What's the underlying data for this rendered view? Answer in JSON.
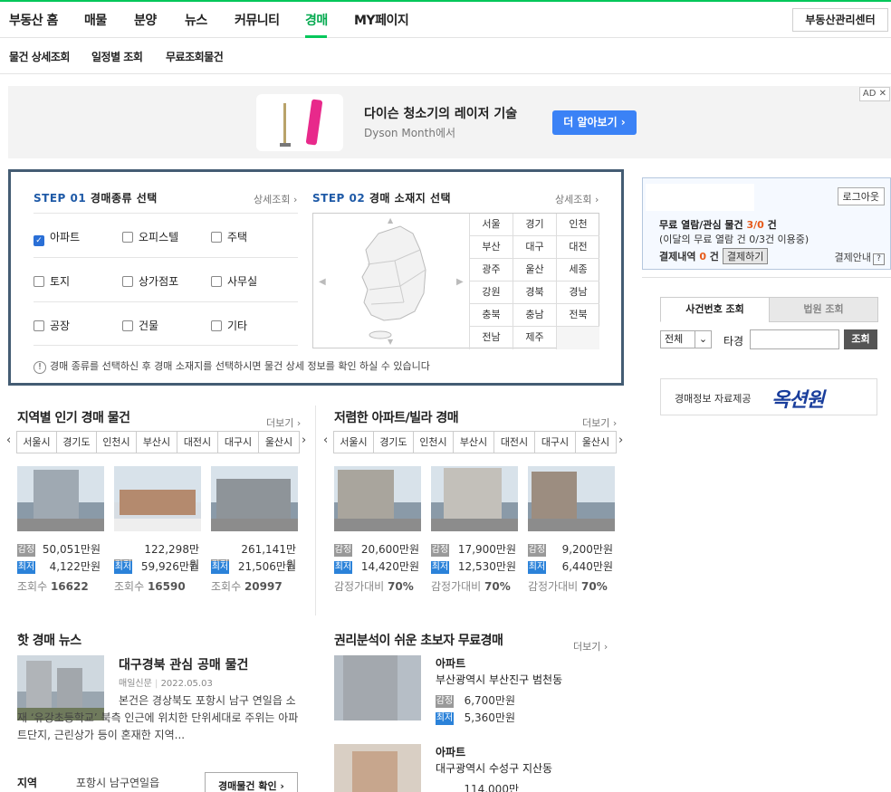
{
  "gnb": {
    "items": [
      "부동산 홈",
      "매물",
      "분양",
      "뉴스",
      "커뮤니티",
      "경매",
      "MY페이지"
    ],
    "realty_center": "부동산관리센터"
  },
  "lnb": {
    "items": [
      "물건 상세조회",
      "일정별 조회",
      "무료조회물건"
    ]
  },
  "ad": {
    "title": "다이슨 청소기의 레이저 기술",
    "sub": "Dyson Month에서",
    "button": "더 알아보기 ›",
    "tag": "AD ✕"
  },
  "step1": {
    "title_num": "STEP 01",
    "title_text": "경매종류 선택",
    "more": "상세조회 ›",
    "options": [
      [
        "아파트",
        "오피스텔",
        "주택"
      ],
      [
        "토지",
        "상가점포",
        "사무실"
      ],
      [
        "공장",
        "건물",
        "기타"
      ]
    ],
    "checked": "아파트"
  },
  "step2": {
    "title_num": "STEP 02",
    "title_text": "경매 소재지 선택",
    "more": "상세조회 ›",
    "regions": [
      "서울",
      "경기",
      "인천",
      "부산",
      "대구",
      "대전",
      "광주",
      "울산",
      "세종",
      "강원",
      "경북",
      "경남",
      "충북",
      "충남",
      "전북",
      "전남",
      "제주",
      ""
    ]
  },
  "notice": "경매 종류를 선택하신 후 경매 소재지를 선택하시면 물건 상세 정보를 확인 하실 수 있습니다",
  "side": {
    "logout": "로그아웃",
    "line1_a": "무료 열람/관심 물건 ",
    "line1_count": "3/0",
    "line1_b": " 건",
    "line2": "(이달의 무료 열람 건 0/3건 이용중)",
    "line3_a": "결제내역 ",
    "line3_count": "0",
    "line3_b": " 건",
    "pay_btn": "결제하기",
    "pay_guide": "결제안내",
    "tab_case": "사건번호 조회",
    "tab_court": "법원 조회",
    "select": "전체",
    "input_label": "타경",
    "search_btn": "조회",
    "provider_text": "경매정보 자료제공",
    "provider_logo": "옥션원"
  },
  "popular": {
    "title": "지역별 인기 경매 물건",
    "more": "더보기 ›",
    "tabs": [
      "서울시",
      "경기도",
      "인천시",
      "부산시",
      "대전시",
      "대구시",
      "울산시"
    ],
    "items": [
      {
        "appraisal": "50,051만원",
        "min": "4,122만원",
        "views_label": "조회수",
        "views": "16622"
      },
      {
        "appraisal": "122,298만원",
        "min": "59,926만원",
        "views_label": "조회수",
        "views": "16590"
      },
      {
        "appraisal": "261,141만원",
        "min": "21,506만원",
        "views_label": "조회수",
        "views": "20997"
      }
    ]
  },
  "cheap": {
    "title": "저렴한 아파트/빌라 경매",
    "more": "더보기 ›",
    "tabs": [
      "서울시",
      "경기도",
      "인천시",
      "부산시",
      "대전시",
      "대구시",
      "울산시"
    ],
    "items": [
      {
        "appraisal": "20,600만원",
        "min": "14,420만원",
        "ratio_label": "감정가대비",
        "ratio": "70%"
      },
      {
        "appraisal": "17,900만원",
        "min": "12,530만원",
        "ratio_label": "감정가대비",
        "ratio": "70%"
      },
      {
        "appraisal": "9,200만원",
        "min": "6,440만원",
        "ratio_label": "감정가대비",
        "ratio": "70%"
      }
    ]
  },
  "labels": {
    "appraisal": "감정",
    "min": "최저"
  },
  "news": {
    "title": "핫 경매 뉴스",
    "headline": "대구경북 관심 공매 물건",
    "source": "매일신문",
    "date": "2022.05.03",
    "body": "본건은 경상북도 포항시 남구 연일읍 소재 ‘유강초등학교’ 북측 인근에 위치한 단위세대로 주위는 아파트단지, 근린상가 등이 혼재한 지역...",
    "region_label": "지역",
    "region_value": "포항시 남구연일읍",
    "btn": "경매물건 확인 ›"
  },
  "easy": {
    "title": "권리분석이 쉬운 초보자 무료경매",
    "more": "더보기 ›",
    "items": [
      {
        "type": "아파트",
        "addr": "부산광역시 부산진구 범천동",
        "appraisal": "6,700만원",
        "min": "5,360만원"
      },
      {
        "type": "아파트",
        "addr": "대구광역시 수성구 지산동",
        "appraisal": "114,000만원"
      }
    ]
  }
}
